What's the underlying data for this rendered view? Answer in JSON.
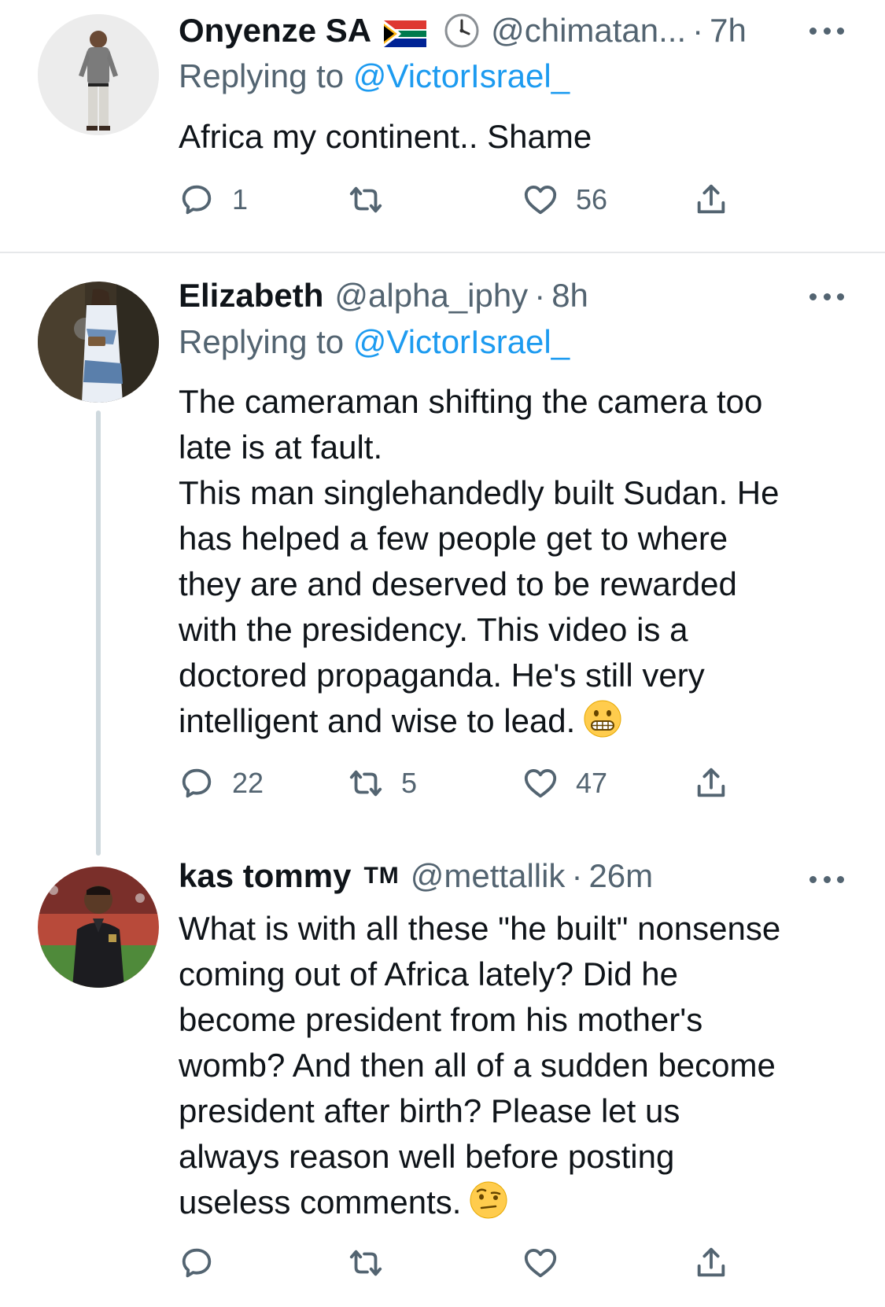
{
  "colors": {
    "text": "#0f1419",
    "secondary": "#536471",
    "accent": "#1d9bf0",
    "divider": "#e6e8ea",
    "thread_line": "#cfd9de"
  },
  "tweets": [
    {
      "display_name": "Onyenze SA",
      "flag_icon": "south-africa-flag-icon",
      "status_icon": "clock-icon",
      "handle": "@chimatan...",
      "separator": "·",
      "time": "7h",
      "replying_prefix": "Replying to ",
      "replying_handle": "@VictorIsrael_",
      "text": "Africa my continent.. Shame",
      "replies": "1",
      "retweets": "",
      "likes": "56"
    },
    {
      "display_name": "Elizabeth",
      "handle": "@alpha_iphy",
      "separator": "·",
      "time": "8h",
      "replying_prefix": "Replying to ",
      "replying_handle": "@VictorIsrael_",
      "text": "The cameraman shifting the camera too\nlate is at fault.\nThis man singlehandedly built Sudan. He\nhas helped a few people get to where\nthey are and deserved to be rewarded\nwith the presidency. This video is a\ndoctored propaganda. He's still very\nintelligent and wise to lead.",
      "emoji_icon": "grimacing-face-emoji-icon",
      "replies": "22",
      "retweets": "5",
      "likes": "47"
    },
    {
      "display_name": "kas tommy",
      "badge": "TM",
      "handle": "@mettallik",
      "separator": "·",
      "time": "26m",
      "text": "What is with all these \"he built\" nonsense\ncoming out of Africa lately? Did he\nbecome president from his mother's\nwomb? And then all of a sudden become\npresident after birth? Please let us\nalways reason well before posting\nuseless comments.",
      "emoji_icon": "face-with-raised-eyebrow-emoji-icon",
      "replies": "",
      "retweets": "",
      "likes": ""
    }
  ]
}
